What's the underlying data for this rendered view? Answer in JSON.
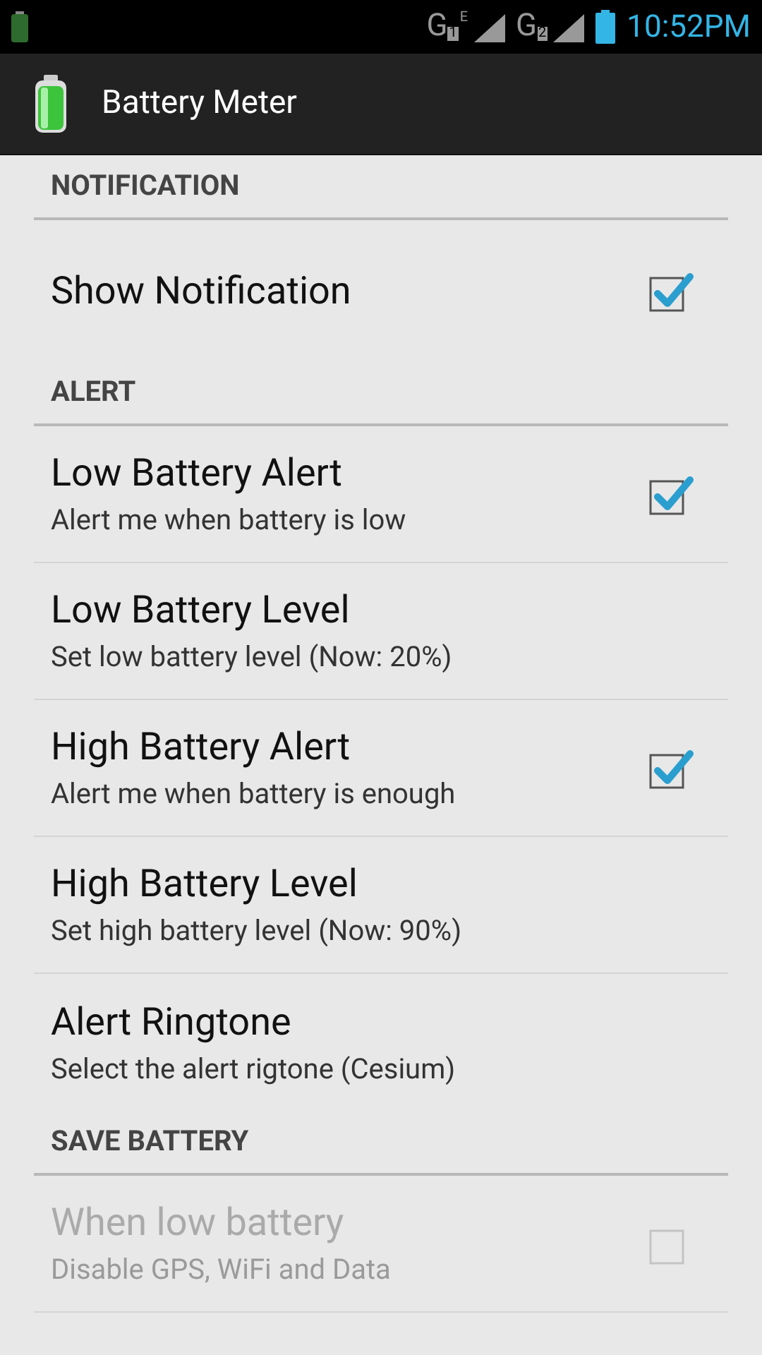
{
  "status_bar": {
    "sims": [
      {
        "label": "G",
        "slot": "1",
        "network": "E"
      },
      {
        "label": "G",
        "slot": "2"
      }
    ],
    "time": "10:52PM"
  },
  "app_bar": {
    "title": "Battery Meter"
  },
  "sections": [
    {
      "title": "NOTIFICATION",
      "items": [
        {
          "kind": "checkbox",
          "title": "Show Notification",
          "checked": true,
          "disabled": false
        }
      ]
    },
    {
      "title": "ALERT",
      "items": [
        {
          "kind": "checkbox",
          "title": "Low Battery Alert",
          "summary": "Alert me when battery is low",
          "checked": true,
          "disabled": false
        },
        {
          "kind": "plain",
          "title": "Low Battery Level",
          "summary": "Set low battery level (Now: 20%)",
          "disabled": false
        },
        {
          "kind": "checkbox",
          "title": "High Battery Alert",
          "summary": "Alert me when battery is enough",
          "checked": true,
          "disabled": false
        },
        {
          "kind": "plain",
          "title": "High Battery Level",
          "summary": "Set high battery level (Now: 90%)",
          "disabled": false
        },
        {
          "kind": "plain",
          "title": "Alert Ringtone",
          "summary": "Select the alert rigtone (Cesium)",
          "disabled": false
        }
      ]
    },
    {
      "title": "SAVE BATTERY",
      "items": [
        {
          "kind": "checkbox",
          "title": "When low battery",
          "summary": "Disable GPS, WiFi and Data",
          "checked": false,
          "disabled": true
        }
      ]
    }
  ]
}
